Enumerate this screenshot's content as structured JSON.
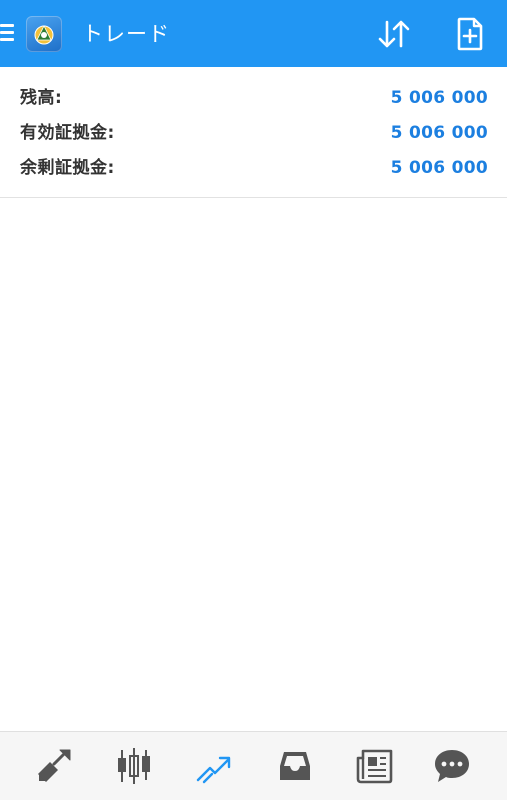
{
  "header": {
    "title": "トレード",
    "menu_icon": "hamburger-menu-icon",
    "logo_icon": "metatrader-logo-icon",
    "sort_icon": "sort-arrows-icon",
    "new_order_icon": "new-document-icon"
  },
  "summary": {
    "rows": [
      {
        "label": "残高:",
        "value": "5 006 000"
      },
      {
        "label": "有効証拠金:",
        "value": "5 006 000"
      },
      {
        "label": "余剰証拠金:",
        "value": "5 006 000"
      }
    ]
  },
  "bottom_nav": {
    "items": [
      {
        "icon": "quotes-arrows-icon",
        "active": false
      },
      {
        "icon": "candlestick-chart-icon",
        "active": false
      },
      {
        "icon": "trade-trend-icon",
        "active": true
      },
      {
        "icon": "history-inbox-icon",
        "active": false
      },
      {
        "icon": "news-icon",
        "active": false
      },
      {
        "icon": "chat-bubble-icon",
        "active": false
      }
    ]
  },
  "colors": {
    "topbar": "#2196F3",
    "value_blue": "#1c7fe0",
    "nav_active": "#2196F3",
    "nav_inactive": "#555555"
  }
}
